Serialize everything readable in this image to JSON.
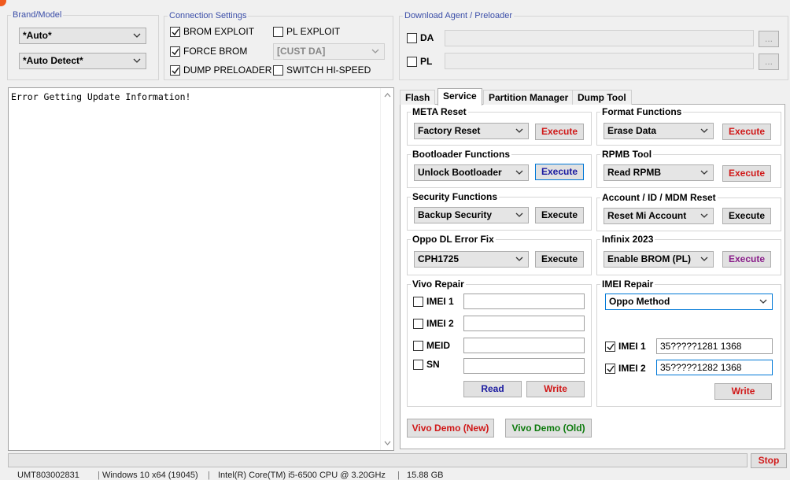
{
  "brand_model": {
    "legend": "Brand/Model",
    "brand_value": "*Auto*",
    "model_value": "*Auto Detect*"
  },
  "connection": {
    "legend": "Connection Settings",
    "brom_exploit": "BROM EXPLOIT",
    "pl_exploit": "PL EXPLOIT",
    "force_brom": "FORCE BROM",
    "cust_da": "[CUST DA]",
    "dump_preloader": "DUMP PRELOADER",
    "switch_hispeed": "SWITCH HI-SPEED"
  },
  "download": {
    "legend": "Download Agent / Preloader",
    "da_label": "DA",
    "pl_label": "PL",
    "browse_label": "..."
  },
  "log": {
    "text": "Error Getting Update Information!"
  },
  "tabs": [
    "Flash",
    "Service",
    "Partition Manager",
    "Dump Tool"
  ],
  "service": {
    "meta_reset": {
      "legend": "META Reset",
      "value": "Factory Reset",
      "button": "Execute"
    },
    "format": {
      "legend": "Format Functions",
      "value": "Erase Data",
      "button": "Execute"
    },
    "bootloader": {
      "legend": "Bootloader Functions",
      "value": "Unlock Bootloader",
      "button": "Execute"
    },
    "rpmb": {
      "legend": "RPMB Tool",
      "value": "Read RPMB",
      "button": "Execute"
    },
    "security": {
      "legend": "Security Functions",
      "value": "Backup Security",
      "button": "Execute"
    },
    "account": {
      "legend": "Account / ID / MDM Reset",
      "value": "Reset Mi Account",
      "button": "Execute"
    },
    "oppo": {
      "legend": "Oppo DL Error Fix",
      "value": "CPH1725",
      "button": "Execute"
    },
    "infinix": {
      "legend": "Infinix 2023",
      "value": "Enable BROM (PL)",
      "button": "Execute"
    },
    "vivo": {
      "legend": "Vivo Repair",
      "imei1": "IMEI 1",
      "imei2": "IMEI 2",
      "meid": "MEID",
      "sn": "SN",
      "read": "Read",
      "write": "Write"
    },
    "imei_repair": {
      "legend": "IMEI Repair",
      "method": "Oppo Method",
      "imei1_label": "IMEI 1",
      "imei1_value": "35?????1281 1368",
      "imei2_label": "IMEI 2",
      "imei2_value": "35?????1282 1368",
      "write": "Write"
    },
    "vivo_demo_new": "Vivo Demo (New)",
    "vivo_demo_old": "Vivo Demo (Old)"
  },
  "stop_label": "Stop",
  "status": {
    "serial": "UMT803002831",
    "os": "Windows 10 x64 (19045)",
    "cpu": "Intel(R) Core(TM) i5-6500 CPU @ 3.20GHz",
    "ram": "15.88 GB"
  },
  "colors": {
    "accent_red": "#d01818",
    "accent_blue": "#1a1aa0",
    "accent_purple": "#8a1e8a",
    "accent_green": "#0c7a0c",
    "legend_blue": "#3b4ea8"
  }
}
